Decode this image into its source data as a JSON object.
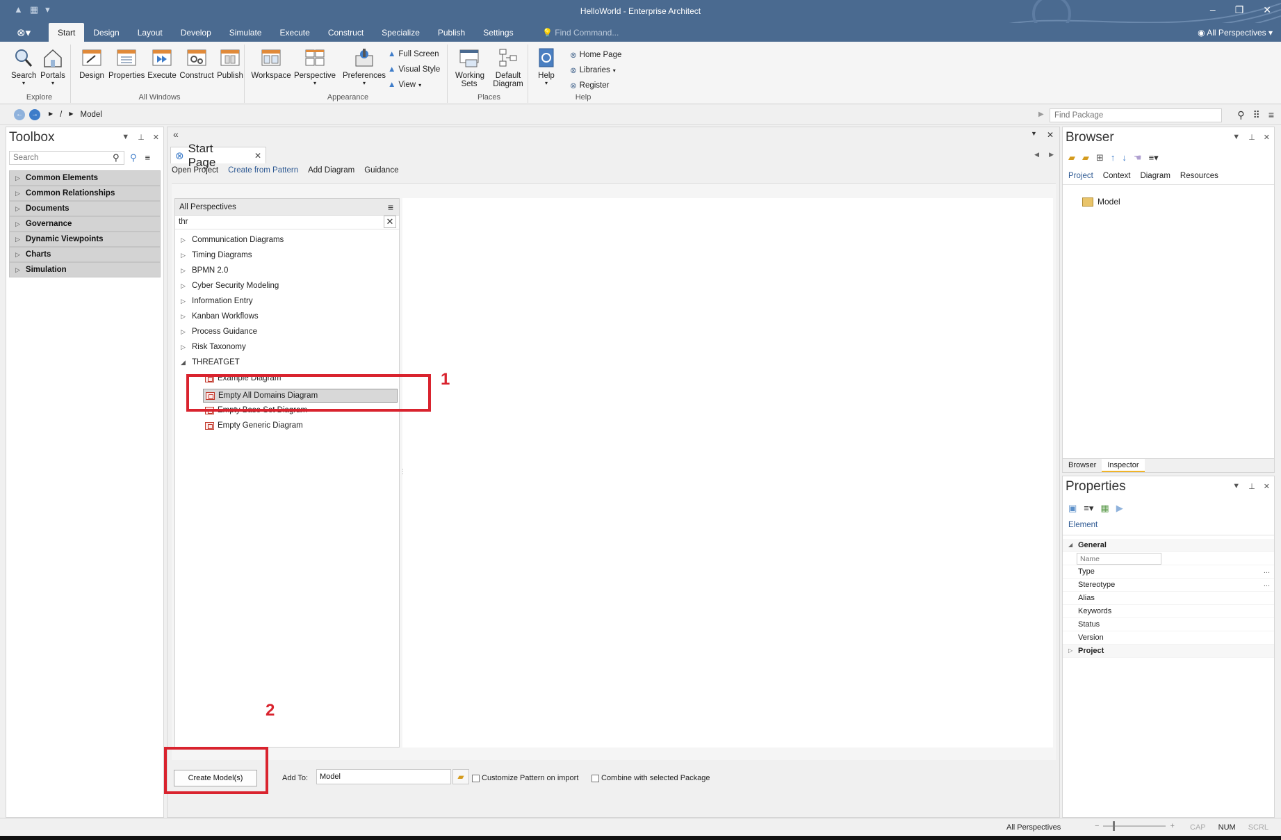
{
  "window": {
    "title": "HelloWorld - Enterprise Architect",
    "minimize": "‒",
    "restore": "❐",
    "close": "✕"
  },
  "menu": {
    "tabs": [
      "Start",
      "Design",
      "Layout",
      "Develop",
      "Simulate",
      "Execute",
      "Construct",
      "Specialize",
      "Publish",
      "Settings"
    ],
    "active_tab": "Start",
    "find_command": "Find Command...",
    "perspectives": "All Perspectives"
  },
  "ribbon": {
    "explore": {
      "label": "Explore",
      "search": "Search",
      "portals": "Portals"
    },
    "all_windows": {
      "label": "All Windows",
      "design": "Design",
      "properties": "Properties",
      "execute": "Execute",
      "construct": "Construct",
      "publish": "Publish"
    },
    "appearance": {
      "label": "Appearance",
      "workspace": "Workspace",
      "perspective": "Perspective",
      "preferences": "Preferences",
      "full_screen": "Full Screen",
      "visual_style": "Visual Style",
      "view": "View"
    },
    "places": {
      "label": "Places",
      "working_sets": "Working Sets",
      "default_diagram": "Default Diagram"
    },
    "help": {
      "label": "Help",
      "help": "Help",
      "home_page": "Home Page",
      "libraries": "Libraries",
      "register": "Register"
    }
  },
  "address": {
    "path_sep": "/",
    "path_model": "Model",
    "find_package_placeholder": "Find Package"
  },
  "toolbox": {
    "title": "Toolbox",
    "search_placeholder": "Search",
    "categories": [
      "Common Elements",
      "Common Relationships",
      "Documents",
      "Governance",
      "Dynamic Viewpoints",
      "Charts",
      "Simulation"
    ]
  },
  "start_page": {
    "tab_title": "Start Page",
    "subtabs": [
      "Open Project",
      "Create from Pattern",
      "Add Diagram",
      "Guidance"
    ],
    "active_subtab": "Create from Pattern",
    "tree_header": "All Perspectives",
    "filter_value": "thr",
    "tree_nodes": [
      "Communication Diagrams",
      "Timing Diagrams",
      "BPMN 2.0",
      "Cyber Security Modeling",
      "Information Entry",
      "Kanban Workflows",
      "Process Guidance",
      "Risk Taxonomy",
      "THREATGET"
    ],
    "threatget_children": [
      "Example Diagram",
      "Empty All Domains Diagram",
      "Empty Base Set Diagram",
      "Empty Generic Diagram"
    ],
    "selected_child": "Empty All Domains Diagram",
    "create_button": "Create Model(s)",
    "add_to_label": "Add To:",
    "add_to_value": "Model",
    "customize_pattern": "Customize Pattern on import",
    "combine_package": "Combine with selected Package"
  },
  "annotations": {
    "one": "1",
    "two": "2",
    "color": "#d9232e"
  },
  "browser": {
    "title": "Browser",
    "tabs": [
      "Project",
      "Context",
      "Diagram",
      "Resources"
    ],
    "active_tab": "Project",
    "root": "Model",
    "bottom_tabs": [
      "Browser",
      "Inspector"
    ]
  },
  "properties": {
    "title": "Properties",
    "tab": "Element",
    "general": "General",
    "name_placeholder": "Name",
    "rows": [
      "Type",
      "Stereotype",
      "Alias",
      "Keywords",
      "Status",
      "Version"
    ],
    "project": "Project"
  },
  "status": {
    "perspective": "All Perspectives",
    "zoom_minus": "−",
    "zoom_plus": "+",
    "cap": "CAP",
    "num": "NUM",
    "scrl": "SCRL"
  },
  "colors": {
    "titlebar": "#4a6a90",
    "accent": "#2f5a93",
    "annotation": "#d9232e"
  }
}
